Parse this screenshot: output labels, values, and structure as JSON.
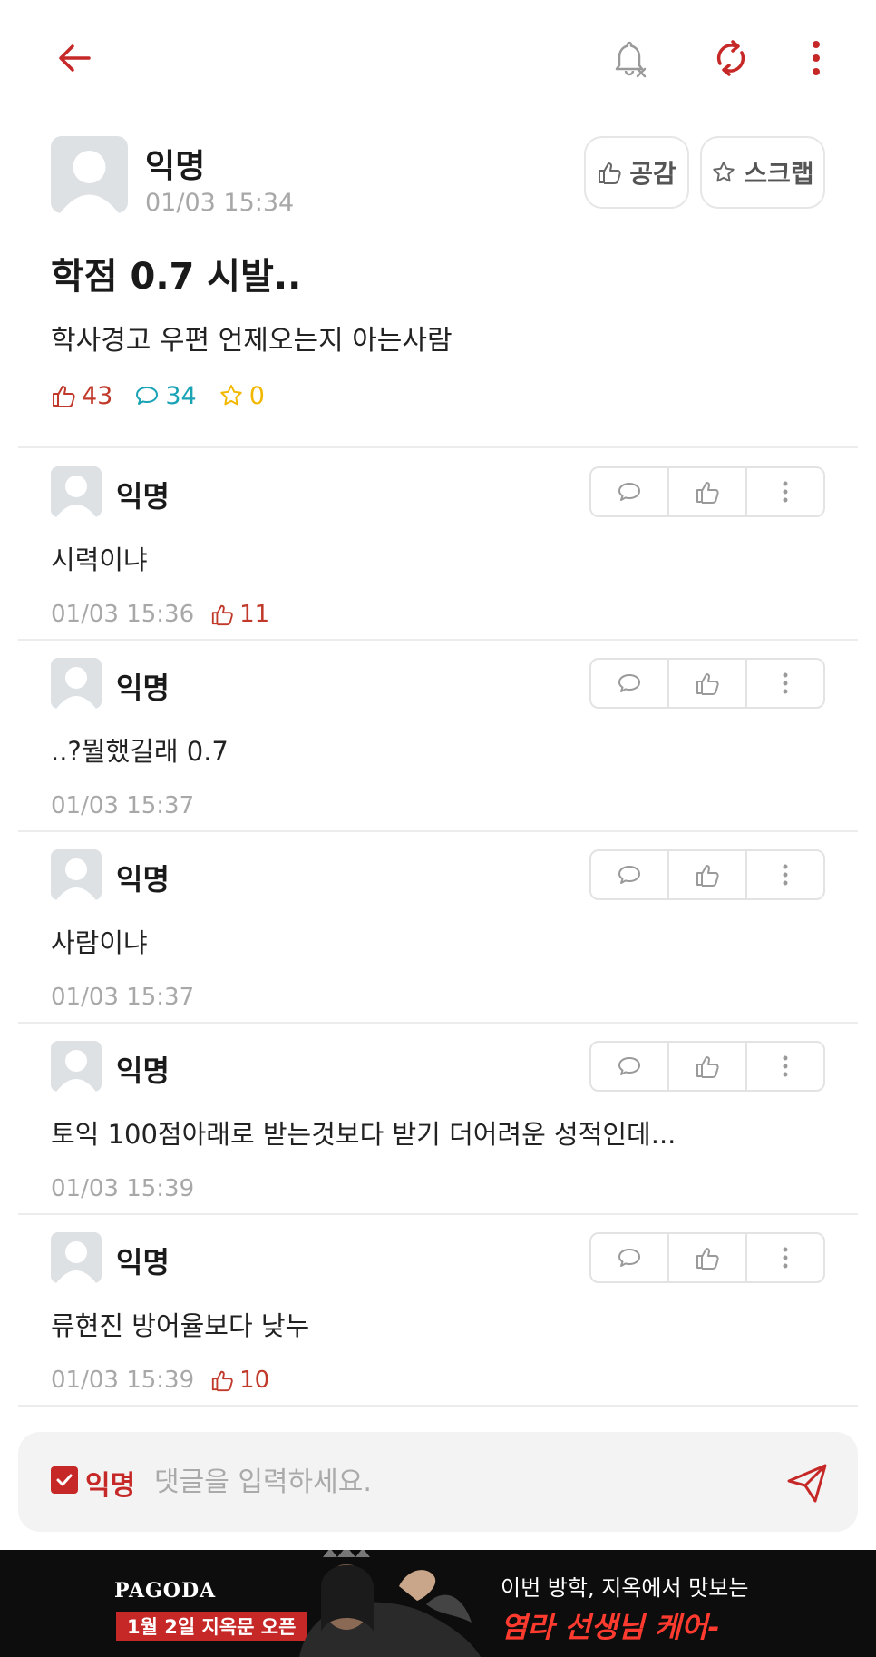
{
  "colors": {
    "accent": "#c62828",
    "like": "#c0392b",
    "comment": "#1aa3b5",
    "scrap": "#f2b800",
    "muted": "#a8a8a8"
  },
  "topbar": {
    "back_icon": "arrow-left-icon",
    "notify_icon": "bell-off-icon",
    "refresh_icon": "refresh-icon",
    "more_icon": "more-vertical-icon"
  },
  "post": {
    "author": "익명",
    "time": "01/03 15:34",
    "empathy_label": "공감",
    "scrap_label": "스크랩",
    "title": "학점 0.7 시발..",
    "body": "학사경고 우편 언제오는지 아는사람",
    "likes": "43",
    "comments": "34",
    "scraps": "0"
  },
  "comments": [
    {
      "author": "익명",
      "text": "시력이냐",
      "time": "01/03 15:36",
      "likes": "11"
    },
    {
      "author": "익명",
      "text": "..?뭘했길래 0.7",
      "time": "01/03 15:37",
      "likes": ""
    },
    {
      "author": "익명",
      "text": "사람이냐",
      "time": "01/03 15:37",
      "likes": ""
    },
    {
      "author": "익명",
      "text": "토익 100점아래로 받는것보다 받기 더어려운 성적인데...",
      "time": "01/03 15:39",
      "likes": ""
    },
    {
      "author": "익명",
      "text": "류현진 방어율보다 낮누",
      "time": "01/03 15:39",
      "likes": "10"
    }
  ],
  "input": {
    "anon_label": "익명",
    "placeholder": "댓글을 입력하세요."
  },
  "ad": {
    "brand": "PAGODA",
    "date_badge": "1월 2일 지옥문 오픈",
    "line1": "이번 방학, 지옥에서 맛보는",
    "line2": "염라 선생님 케어-"
  }
}
